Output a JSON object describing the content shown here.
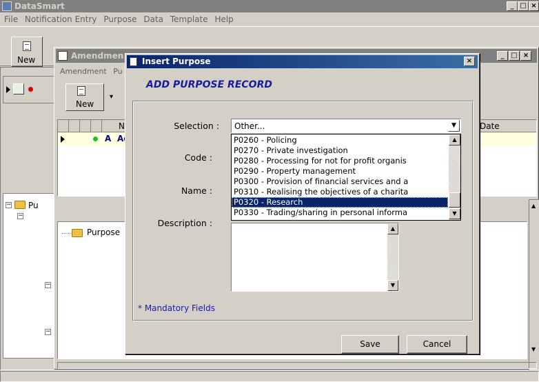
{
  "app": {
    "title": "DataSmart",
    "menu": [
      "File",
      "Notification Entry",
      "Purpose",
      "Data",
      "Template",
      "Help"
    ],
    "toolbar": {
      "new_label": "New"
    }
  },
  "child_window": {
    "title": "Amendmen",
    "menu": [
      "Amendment",
      "Pu"
    ],
    "toolbar": {
      "new_label": "New"
    },
    "grid": {
      "headers": [
        "Na",
        "Date"
      ],
      "row": {
        "status": "A",
        "name": "Ac"
      }
    },
    "tree": {
      "root": "Pu",
      "child": "Purpose"
    }
  },
  "dialog": {
    "title": "Insert Purpose",
    "heading": "ADD PURPOSE RECORD",
    "fields": {
      "selection_label": "Selection :",
      "code_label": "Code :",
      "name_label": "Name :",
      "description_label": "Description :"
    },
    "selection_value": "Other...",
    "options": [
      "P0260 - Policing",
      "P0270 - Private investigation",
      "P0280 - Processing for not for profit organis",
      "P0290 - Property management",
      "P0300 - Provision of financial services and a",
      "P0310 - Realising the objectives of a charita",
      "P0320 - Research",
      "P0330 - Trading/sharing in personal informa"
    ],
    "selected_index": 6,
    "mandatory_note": "* Mandatory Fields",
    "buttons": {
      "save": "Save",
      "cancel": "Cancel"
    }
  }
}
